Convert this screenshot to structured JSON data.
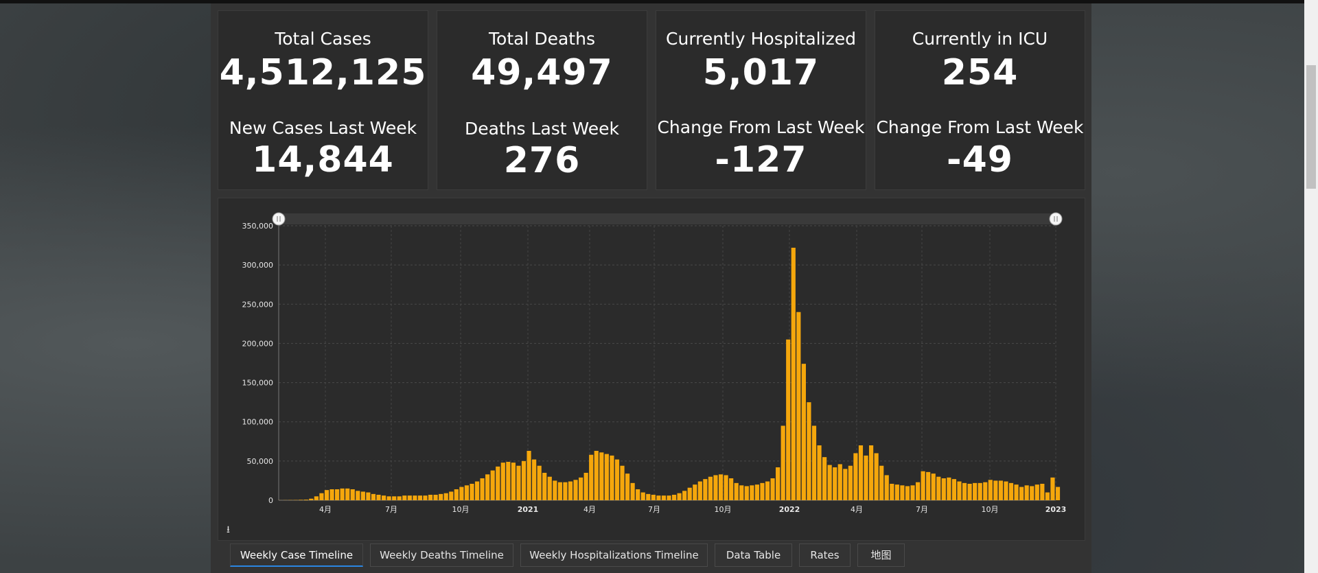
{
  "kpis": [
    {
      "top_label": "Total Cases",
      "top_value": "4,512,125",
      "bottom_label": "New Cases Last Week",
      "bottom_value": "14,844"
    },
    {
      "top_label": "Total Deaths",
      "top_value": "49,497",
      "bottom_label": "Deaths Last Week",
      "bottom_value": "276"
    },
    {
      "top_label": "Currently Hospitalized",
      "top_value": "5,017",
      "bottom_label": "Change From Last Week",
      "bottom_value": "-127"
    },
    {
      "top_label": "Currently in ICU",
      "top_value": "254",
      "bottom_label": "Change From Last Week",
      "bottom_value": "-49"
    }
  ],
  "tabs": [
    {
      "label": "Weekly Case Timeline",
      "active": true
    },
    {
      "label": "Weekly Deaths Timeline",
      "active": false
    },
    {
      "label": "Weekly Hospitalizations Timeline",
      "active": false
    },
    {
      "label": "Data Table",
      "active": false
    },
    {
      "label": "Rates",
      "active": false
    },
    {
      "label": "地图",
      "active": false
    }
  ],
  "icons": {
    "download": "download-icon",
    "range_handle": "range-handle-icon"
  },
  "colors": {
    "bar": "#f5a70c",
    "background": "#2b2b2b",
    "tab_accent": "#2b87e3"
  },
  "chart_data": {
    "type": "bar",
    "title": "",
    "xlabel": "",
    "ylabel": "",
    "ylim": [
      0,
      350000
    ],
    "y_ticks": [
      "0",
      "50,000",
      "100,000",
      "150,000",
      "200,000",
      "250,000",
      "300,000",
      "350,000"
    ],
    "x_ticks": [
      {
        "label": "4月",
        "bold": false
      },
      {
        "label": "7月",
        "bold": false
      },
      {
        "label": "10月",
        "bold": false
      },
      {
        "label": "2021",
        "bold": true
      },
      {
        "label": "4月",
        "bold": false
      },
      {
        "label": "7月",
        "bold": false
      },
      {
        "label": "10月",
        "bold": false
      },
      {
        "label": "2022",
        "bold": true
      },
      {
        "label": "4月",
        "bold": false
      },
      {
        "label": "7月",
        "bold": false
      },
      {
        "label": "10月",
        "bold": false
      },
      {
        "label": "2023",
        "bold": true
      }
    ],
    "grid": true,
    "legend": "none",
    "values": [
      100,
      200,
      300,
      400,
      600,
      800,
      2000,
      5000,
      9000,
      13000,
      14000,
      14000,
      15000,
      15000,
      14000,
      12000,
      11000,
      10000,
      8000,
      7000,
      6000,
      5000,
      5000,
      5000,
      6000,
      6000,
      6000,
      6000,
      6000,
      7000,
      7000,
      8000,
      9000,
      11000,
      14000,
      17000,
      19000,
      21000,
      24000,
      28000,
      33000,
      38000,
      43000,
      48000,
      49000,
      48000,
      44000,
      50000,
      63000,
      52000,
      44000,
      35000,
      30000,
      25000,
      23000,
      23000,
      24000,
      26000,
      29000,
      35000,
      58000,
      63000,
      61000,
      59000,
      57000,
      52000,
      44000,
      34000,
      22000,
      14000,
      10000,
      8000,
      7000,
      6000,
      6000,
      6000,
      7000,
      9000,
      12000,
      16000,
      20000,
      24000,
      27000,
      30000,
      32000,
      33000,
      32000,
      28000,
      22000,
      19000,
      18000,
      19000,
      20000,
      22000,
      24000,
      28000,
      42000,
      95000,
      205000,
      322000,
      240000,
      174000,
      125000,
      95000,
      70000,
      55000,
      45000,
      42000,
      46000,
      40000,
      44000,
      60000,
      70000,
      57000,
      70000,
      60000,
      44000,
      32000,
      21000,
      20000,
      19000,
      18000,
      19000,
      23000,
      37000,
      36000,
      34000,
      30000,
      28000,
      29000,
      27000,
      24000,
      22000,
      21000,
      22000,
      22000,
      23000,
      26000,
      25000,
      25000,
      24000,
      22000,
      20000,
      17000,
      19000,
      18000,
      20000,
      21000,
      10000,
      29000,
      17000
    ]
  }
}
